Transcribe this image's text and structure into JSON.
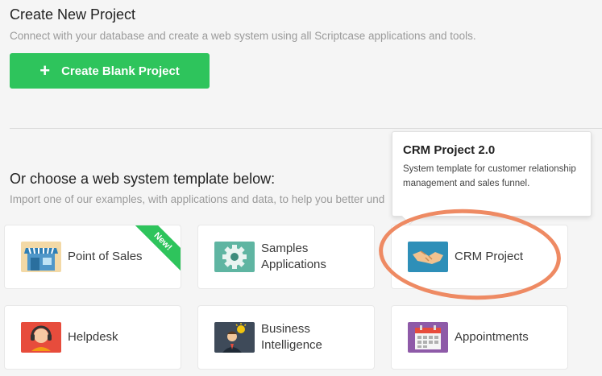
{
  "header": {
    "title": "Create New Project",
    "subtitle": "Connect with your database and create a web system using all Scriptcase applications and tools.",
    "create_button": "Create Blank Project"
  },
  "templates": {
    "title": "Or choose a web system template below:",
    "subtitle": "Import one of our examples, with applications and data, to help you better und",
    "cards": [
      {
        "label": "Point of Sales",
        "icon": "store-icon",
        "badge": "New!"
      },
      {
        "label": "Samples Applications",
        "icon": "gear-icon"
      },
      {
        "label": "CRM Project",
        "icon": "handshake-icon"
      },
      {
        "label": "Helpdesk",
        "icon": "headset-icon"
      },
      {
        "label": "Business Intelligence",
        "icon": "businessman-icon"
      },
      {
        "label": "Appointments",
        "icon": "calendar-icon"
      }
    ]
  },
  "tooltip": {
    "title": "CRM Project 2.0",
    "description": "System template for customer relationship management and sales funnel."
  },
  "colors": {
    "accent_green": "#2ec45c",
    "highlight_orange": "#ee8a63",
    "background": "#f5f5f5"
  }
}
